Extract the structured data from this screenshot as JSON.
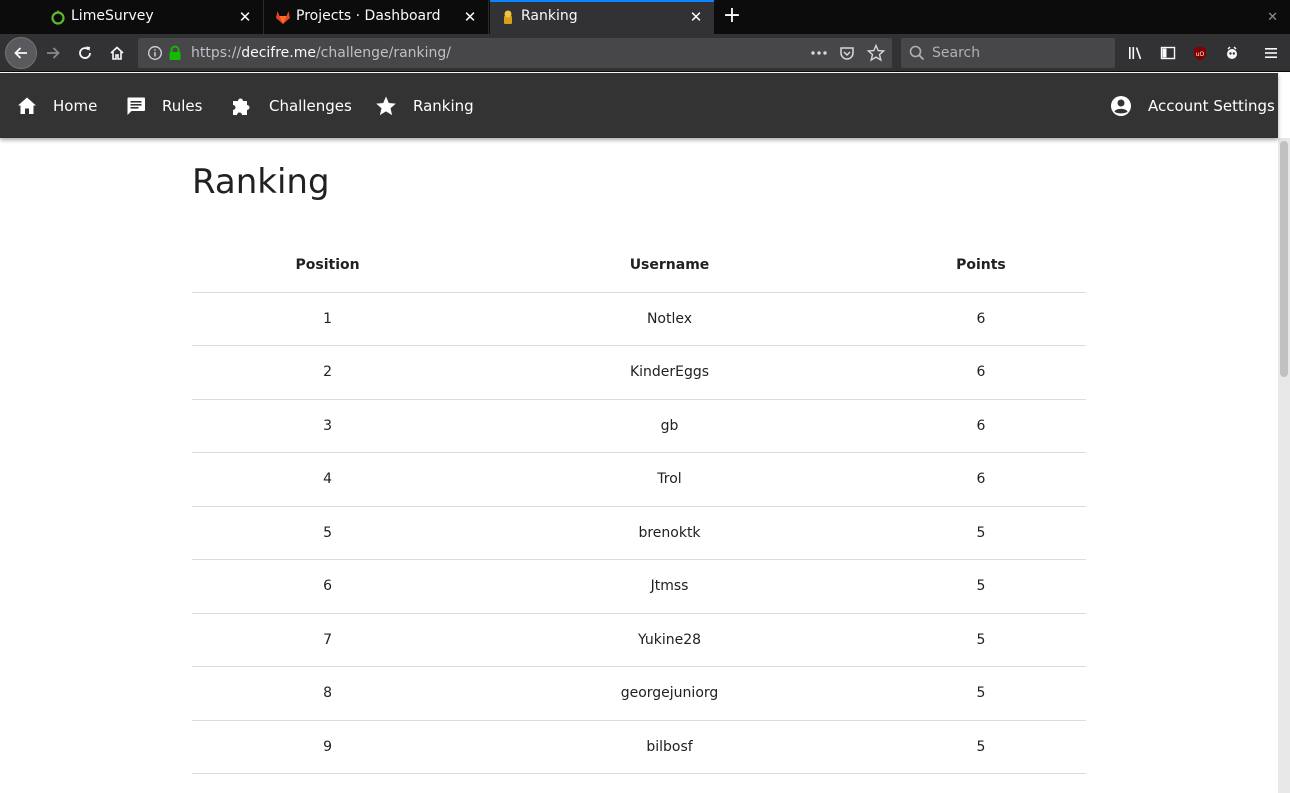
{
  "browser": {
    "tabs": [
      {
        "title": "LimeSurvey",
        "active": false
      },
      {
        "title": "Projects · Dashboard · Gi",
        "active": false
      },
      {
        "title": "Ranking",
        "active": true
      }
    ],
    "url": {
      "scheme": "https://",
      "domain": "decifre.me",
      "path": "/challenge/ranking/"
    },
    "search_placeholder": "Search",
    "accent_color": "#0a84ff"
  },
  "site_nav": {
    "items": [
      {
        "label": "Home",
        "icon": "home-icon"
      },
      {
        "label": "Rules",
        "icon": "comment-icon"
      },
      {
        "label": "Challenges",
        "icon": "puzzle-icon"
      },
      {
        "label": "Ranking",
        "icon": "star-icon"
      }
    ],
    "account": {
      "label": "Account Settings",
      "icon": "account-circle-icon"
    }
  },
  "page": {
    "title": "Ranking",
    "table": {
      "columns": [
        "Position",
        "Username",
        "Points"
      ],
      "rows": [
        [
          "1",
          "Notlex",
          "6"
        ],
        [
          "2",
          "KinderEggs",
          "6"
        ],
        [
          "3",
          "gb",
          "6"
        ],
        [
          "4",
          "Trol",
          "6"
        ],
        [
          "5",
          "brenoktk",
          "5"
        ],
        [
          "6",
          "Jtmss",
          "5"
        ],
        [
          "7",
          "Yukine28",
          "5"
        ],
        [
          "8",
          "georgejuniorg",
          "5"
        ],
        [
          "9",
          "bilbosf",
          "5"
        ]
      ]
    }
  }
}
